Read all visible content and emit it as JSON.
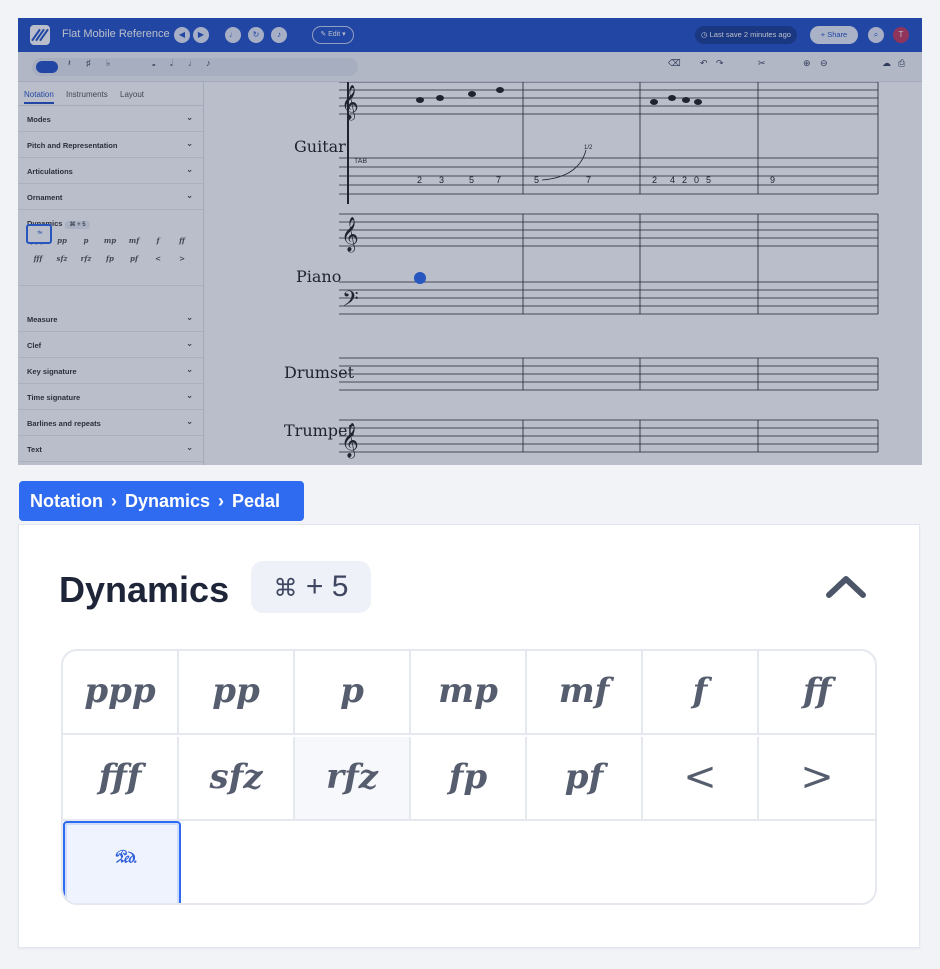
{
  "app": {
    "title": "Flat Mobile Reference",
    "edit_label": "Edit",
    "last_save": "Last save 2 minutes ago",
    "share_label": "Share",
    "avatar_initial": "T"
  },
  "sidebar": {
    "tabs": [
      "Notation",
      "Instruments",
      "Layout"
    ],
    "sections_before": [
      "Modes",
      "Pitch and Representation",
      "Articulations",
      "Ornament"
    ],
    "dynamics_label": "Dynamics",
    "dynamics_shortcut": "⌘ + 5",
    "sections_after": [
      "Measure",
      "Clef",
      "Key signature",
      "Time signature",
      "Barlines and repeats",
      "Text"
    ]
  },
  "score": {
    "instruments": [
      "Guitar",
      "Piano",
      "Drumset",
      "Trumpet"
    ],
    "tab_letters": "TAB",
    "fret_m1": [
      "2",
      "3",
      "5",
      "7"
    ],
    "fret_m2": [
      "5",
      "7"
    ],
    "bend_label": "1/2",
    "fret_m3": [
      "2",
      "4",
      "2",
      "0",
      "5"
    ],
    "fret_m4": [
      "9"
    ]
  },
  "breadcrumb": [
    "Notation",
    "Dynamics",
    "Pedal"
  ],
  "panel": {
    "title": "Dynamics",
    "shortcut_cmd": "⌘",
    "shortcut_rest": "+ 5",
    "items": [
      "ppp",
      "pp",
      "p",
      "mp",
      "mf",
      "f",
      "ff",
      "fff",
      "sfz",
      "rfz",
      "fp",
      "pf",
      "<",
      ">",
      "𝆮"
    ],
    "selected_item": "Pedal"
  },
  "colors": {
    "brand": "#2753c8",
    "accent": "#2f6bf0"
  }
}
